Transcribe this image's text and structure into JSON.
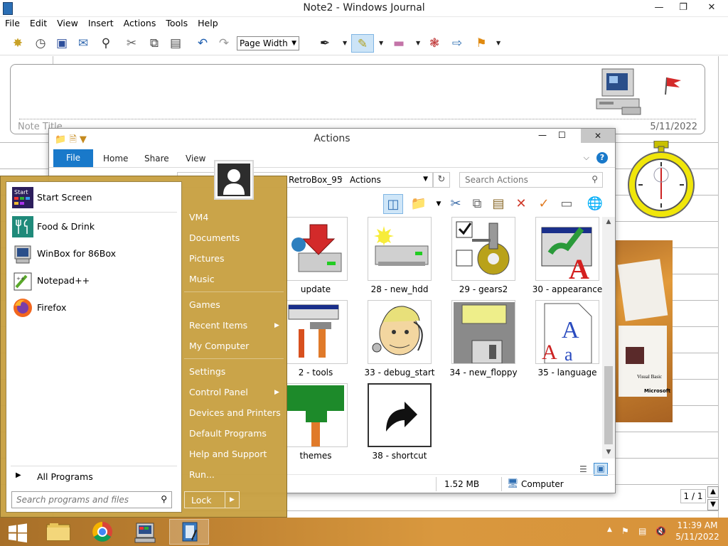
{
  "journal": {
    "title": "Note2 - Windows Journal",
    "menu": [
      "File",
      "Edit",
      "View",
      "Insert",
      "Actions",
      "Tools",
      "Help"
    ],
    "zoom_select": "Page Width",
    "note_title_placeholder": "Note Title",
    "note_date": "5/11/2022",
    "page_indicator": "1 / 1",
    "photo_caption1": "Visual Basic",
    "photo_caption2": "Microsoft"
  },
  "explorer": {
    "title": "Actions",
    "ribbon_tabs": [
      "File",
      "Home",
      "Share",
      "View"
    ],
    "breadcrumb": [
      "RetroBox_95",
      "Actions"
    ],
    "search_placeholder": "Search Actions",
    "items": [
      {
        "label": "update",
        "icon": "update-icon"
      },
      {
        "label": "28 - new_hdd",
        "icon": "new-hdd-icon"
      },
      {
        "label": "29 - gears2",
        "icon": "gears-icon"
      },
      {
        "label": "30 - appearance",
        "icon": "appearance-icon"
      },
      {
        "label": "2 - tools",
        "icon": "tools-icon"
      },
      {
        "label": "33 - debug_start",
        "icon": "debug-start-icon"
      },
      {
        "label": "34 - new_floppy",
        "icon": "new-floppy-icon"
      },
      {
        "label": "35 - language",
        "icon": "language-icon"
      },
      {
        "label": "themes",
        "icon": "themes-icon"
      },
      {
        "label": "38 - shortcut",
        "icon": "shortcut-icon"
      }
    ],
    "status_size": "1.52 MB",
    "status_location": "Computer"
  },
  "start_menu": {
    "pinned": [
      {
        "label": "Start Screen",
        "icon": "start-screen-icon"
      },
      {
        "label": "Food & Drink",
        "icon": "food-drink-icon"
      },
      {
        "label": "WinBox for 86Box",
        "icon": "winbox-icon"
      },
      {
        "label": "Notepad++",
        "icon": "notepad-plus-icon"
      },
      {
        "label": "Firefox",
        "icon": "firefox-icon"
      }
    ],
    "all_programs": "All Programs",
    "search_placeholder": "Search programs and files",
    "right_items": [
      "VM4",
      "Documents",
      "Pictures",
      "Music",
      "Games",
      "Recent Items",
      "My Computer",
      "Settings",
      "Control Panel",
      "Devices and Printers",
      "Default Programs",
      "Help and Support",
      "Run..."
    ],
    "lock_label": "Lock"
  },
  "taskbar": {
    "time": "11:39 AM",
    "date": "5/11/2022"
  },
  "colors": {
    "accent_blue": "#1979ca",
    "start_menu_gold": "#c8a042",
    "taskbar_orange": "#c88a36"
  }
}
